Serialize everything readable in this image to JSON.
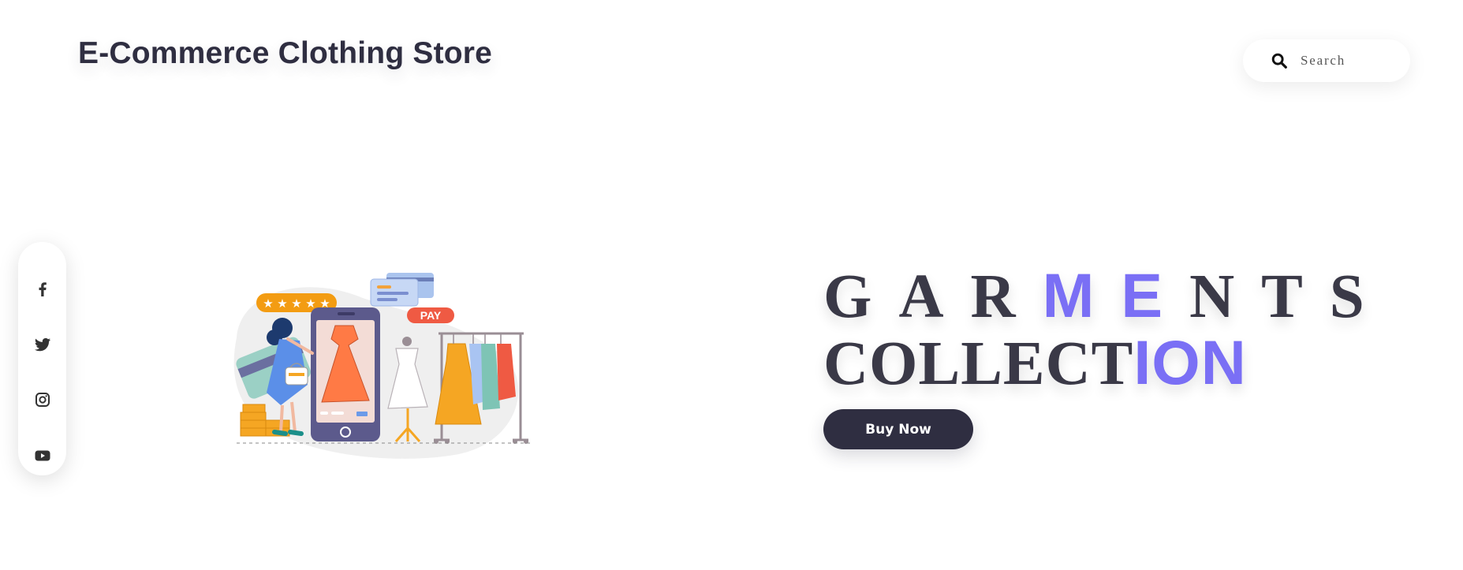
{
  "header": {
    "brand": "E-Commerce Clothing Store",
    "search_placeholder": "Search"
  },
  "social": [
    {
      "name": "facebook-icon"
    },
    {
      "name": "twitter-icon"
    },
    {
      "name": "instagram-icon"
    },
    {
      "name": "youtube-icon"
    }
  ],
  "hero": {
    "line1_main": "GAR",
    "line1_accent": "ME",
    "line1_rest": "NTS",
    "line2_main": "COLLECT",
    "line2_accent": "ION",
    "cta_label": "Buy Now",
    "illustration_label": "PAY"
  },
  "colors": {
    "accent": "#7a6ff5",
    "dark": "#2f2e41",
    "orange": "#ff7a45"
  }
}
